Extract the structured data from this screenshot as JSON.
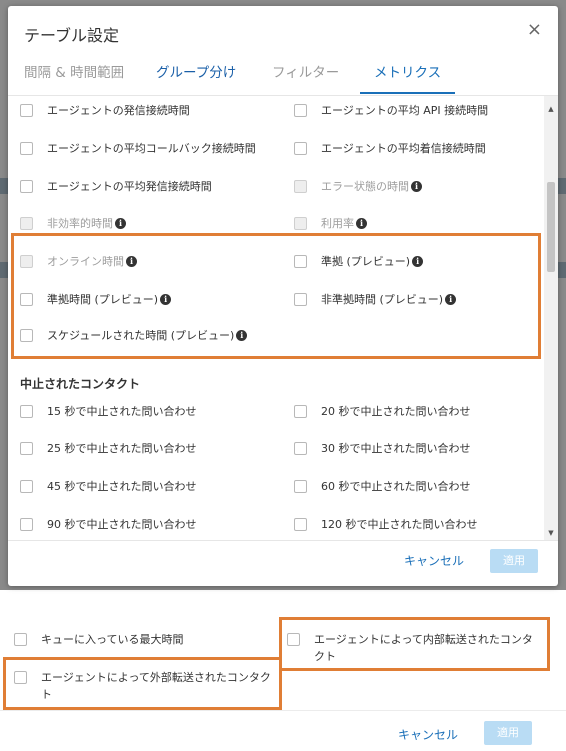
{
  "dialog": {
    "title": "テーブル設定",
    "close_glyph": "×",
    "tabs": [
      {
        "label": "間隔 & 時間範囲",
        "state": "disabled"
      },
      {
        "label": "グループ分け",
        "state": "link"
      },
      {
        "label": "フィルター",
        "state": "disabled"
      },
      {
        "label": "メトリクス",
        "state": "active"
      }
    ],
    "metrics": {
      "row1_left": "エージェントの発信接続時間",
      "row1_right": "エージェントの平均 API 接続時間",
      "row2_left": "エージェントの平均コールバック接続時間",
      "row2_right": "エージェントの平均着信接続時間",
      "row3_left": "エージェントの平均発信接続時間",
      "row3_right": "エラー状態の時間",
      "row4_left": "非効率的時間",
      "row4_right": "利用率",
      "row5_left": "オンライン時間",
      "row5_right": "準拠 (プレビュー)",
      "row6_left": "準拠時間 (プレビュー)",
      "row6_right": "非準拠時間 (プレビュー)",
      "row7_left": "スケジュールされた時間 (プレビュー)"
    },
    "section_abandoned": {
      "heading": "中止されたコンタクト",
      "items": [
        "15 秒で中止された問い合わせ",
        "20 秒で中止された問い合わせ",
        "25 秒で中止された問い合わせ",
        "30 秒で中止された問い合わせ",
        "45 秒で中止された問い合わせ",
        "60 秒で中止された問い合わせ",
        "90 秒で中止された問い合わせ",
        "120 秒で中止された問い合わせ"
      ]
    },
    "info_glyph": "i",
    "scroll_up_glyph": "▲",
    "scroll_down_glyph": "▼",
    "cancel_label": "キャンセル",
    "apply_label": "適用"
  },
  "lower_panel": {
    "item_queue_max": "キューに入っている最大時間",
    "item_internal_transfer": "エージェントによって内部転送されたコンタクト",
    "item_external_transfer": "エージェントによって外部転送されたコンタクト",
    "cancel_label": "キャンセル",
    "apply_label": "適用"
  },
  "colors": {
    "highlight": "#e07e35",
    "accent": "#1a6fb8",
    "apply_disabled": "#b9dcf4"
  }
}
